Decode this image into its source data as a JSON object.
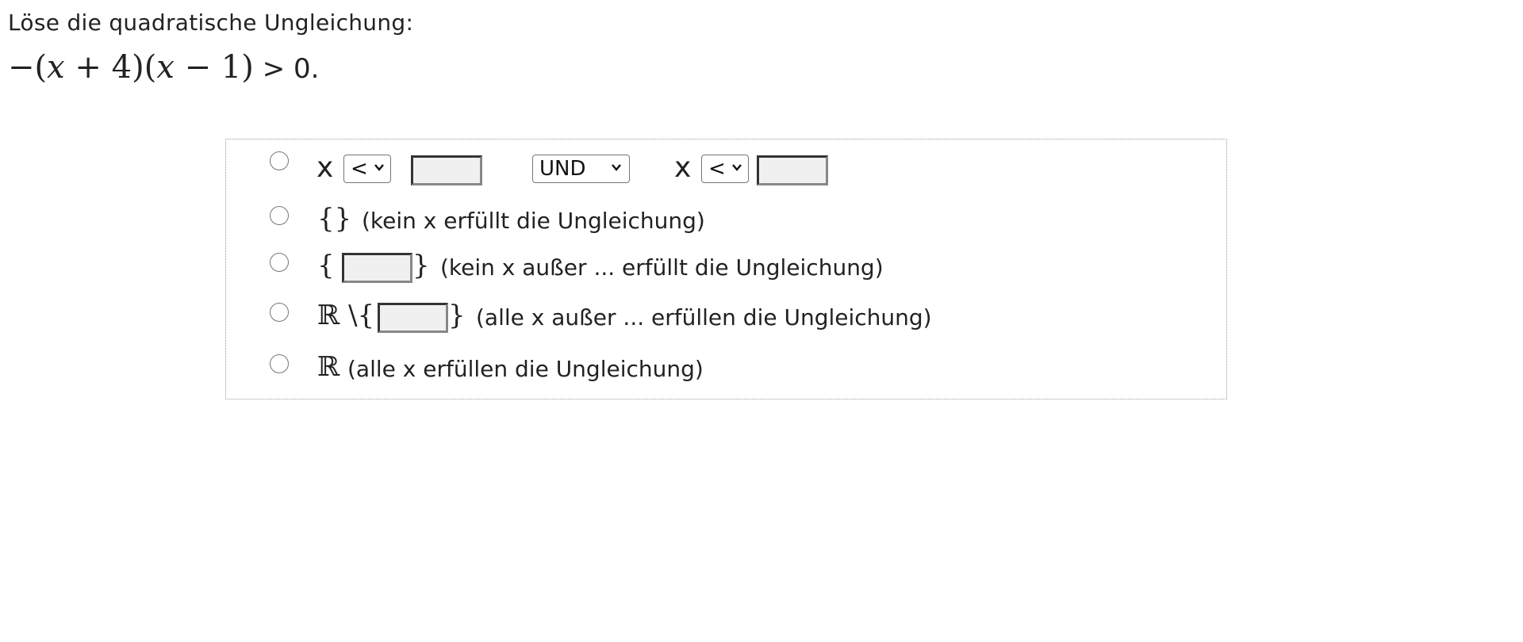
{
  "question": {
    "prompt": "Löse die quadratische Ungleichung:",
    "inequality": {
      "minus": "−",
      "open1": "(",
      "x1": "x",
      "plus": " + 4",
      "close1": ")",
      "open2": "(",
      "x2": "x",
      "minus2": " − 1",
      "close2": ")",
      "rest": " > 0."
    }
  },
  "options": {
    "interval": {
      "x_left": "x",
      "op_left": "<",
      "value_left": "",
      "connector": "UND",
      "x_right": "x",
      "op_right": "<",
      "value_right": ""
    },
    "empty_set": {
      "symbol": "{}",
      "label": "(kein x erfüllt die Ungleichung)"
    },
    "single_point": {
      "open": "{",
      "value": "",
      "close": "}",
      "label": "(kein x außer ... erfüllt die Ungleichung)"
    },
    "reals_except": {
      "prefix": "ℝ \\{",
      "value": "",
      "close": "}",
      "label": "(alle x außer ... erfüllen die Ungleichung)"
    },
    "all_reals": {
      "symbol": "ℝ",
      "label": "(alle x erfüllen die Ungleichung)"
    }
  },
  "icons": {
    "select_arrow": "chevron-down-icon"
  }
}
